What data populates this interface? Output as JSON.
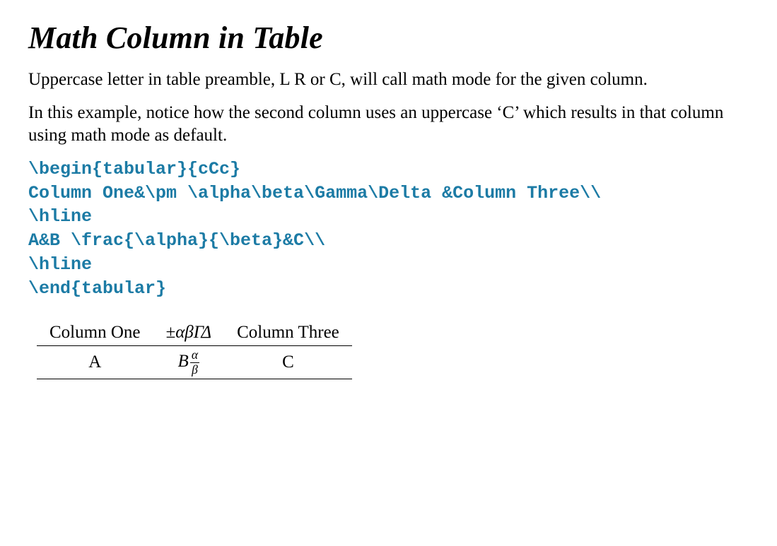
{
  "title": "Math Column in Table",
  "para1": "Uppercase letter in table preamble, L R or C, will call math mode for the given column.",
  "para2": "In this example, notice how the second column uses an uppercase ‘C’ which results in that column using math mode as default.",
  "code": "\\begin{tabular}{cCc}\nColumn One&\\pm \\alpha\\beta\\Gamma\\Delta &Column Three\\\\\n\\hline\nA&B \\frac{\\alpha}{\\beta}&C\\\\\n\\hline\n\\end{tabular}",
  "table": {
    "row1": {
      "c1": "Column One",
      "c2": "±αβΓΔ",
      "c3": "Column Three"
    },
    "row2": {
      "c1": "A",
      "c2_prefix": "B",
      "c2_num": "α",
      "c2_den": "β",
      "c3": "C"
    }
  }
}
